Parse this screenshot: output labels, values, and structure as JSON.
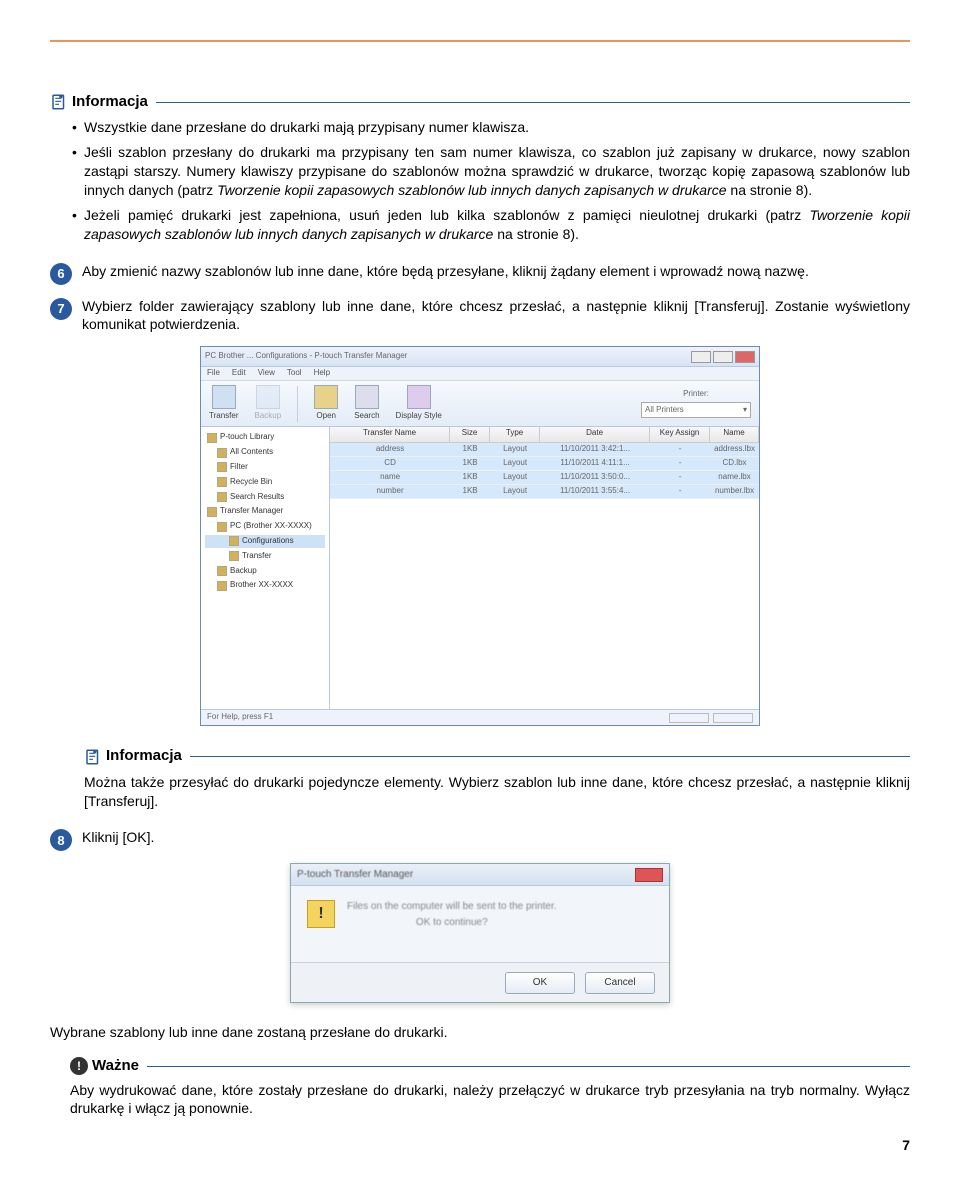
{
  "note1": {
    "title": "Informacja",
    "bullets": [
      {
        "text": "Wszystkie dane przesłane do drukarki mają przypisany numer klawisza."
      },
      {
        "text": "Jeśli szablon przesłany do drukarki ma przypisany ten sam numer klawisza, co szablon już zapisany w drukarce, nowy szablon zastąpi starszy. Numery klawiszy przypisane do szablonów można sprawdzić w drukarce, tworząc kopię zapasową szablonów lub innych danych (patrz ",
        "italic": "Tworzenie kopii zapasowych szablonów lub innych danych zapisanych w drukarce",
        "after": " na stronie 8)."
      },
      {
        "text": "Jeżeli pamięć drukarki jest zapełniona, usuń jeden lub kilka szablonów z pamięci nieulotnej drukarki (patrz ",
        "italic": "Tworzenie kopii zapasowych szablonów lub innych danych zapisanych w drukarce",
        "after": " na stronie 8)."
      }
    ]
  },
  "step6": {
    "num": "6",
    "text": "Aby zmienić nazwy szablonów lub inne dane, które będą przesyłane, kliknij żądany element i wprowadź nową nazwę."
  },
  "step7": {
    "num": "7",
    "text": "Wybierz folder zawierający szablony lub inne dane, które chcesz przesłać, a następnie kliknij [Transferuj]. Zostanie wyświetlony komunikat potwierdzenia."
  },
  "screenshot1": {
    "title": "PC Brother ... Configurations - P-touch Transfer Manager",
    "menu": [
      "File",
      "Edit",
      "View",
      "Tool",
      "Help"
    ],
    "toolbar": [
      "Transfer",
      "Backup",
      "Open",
      "Search",
      "Display Style"
    ],
    "printerLabel": "Printer:",
    "printerCombo": "All Printers",
    "tree": [
      {
        "label": "P-touch Library",
        "indent": 0
      },
      {
        "label": "All Contents",
        "indent": 1
      },
      {
        "label": "Filter",
        "indent": 1
      },
      {
        "label": "Recycle Bin",
        "indent": 1
      },
      {
        "label": "Search Results",
        "indent": 1
      },
      {
        "label": "Transfer Manager",
        "indent": 0
      },
      {
        "label": "PC (Brother XX-XXXX)",
        "indent": 1
      },
      {
        "label": "Configurations",
        "indent": 2,
        "sel": true
      },
      {
        "label": "Transfer",
        "indent": 2
      },
      {
        "label": "Backup",
        "indent": 1
      },
      {
        "label": "Brother XX-XXXX",
        "indent": 1
      }
    ],
    "cols": [
      "Transfer Name",
      "Size",
      "Type",
      "Date",
      "Key Assign",
      "Name"
    ],
    "rows": [
      {
        "sel": true,
        "cells": [
          "address",
          "1KB",
          "Layout",
          "11/10/2011 3:42:1...",
          "-",
          "address.lbx"
        ]
      },
      {
        "sel": true,
        "cells": [
          "CD",
          "1KB",
          "Layout",
          "11/10/2011 4:11:1...",
          "-",
          "CD.lbx"
        ]
      },
      {
        "sel": true,
        "cells": [
          "name",
          "1KB",
          "Layout",
          "11/10/2011 3:50:0...",
          "-",
          "name.lbx"
        ]
      },
      {
        "sel": true,
        "cells": [
          "number",
          "1KB",
          "Layout",
          "11/10/2011 3:55:4...",
          "-",
          "number.lbx"
        ]
      }
    ],
    "status": "For Help, press F1"
  },
  "note2": {
    "title": "Informacja",
    "text": "Można także przesyłać do drukarki pojedyncze elementy. Wybierz szablon lub inne dane, które chcesz przesłać, a następnie kliknij [Transferuj]."
  },
  "step8": {
    "num": "8",
    "text": "Kliknij [OK]."
  },
  "screenshot2": {
    "title": "P-touch Transfer Manager",
    "line1": "Files on the computer will be sent to the printer.",
    "line2": "OK to continue?",
    "ok": "OK",
    "cancel": "Cancel"
  },
  "afterStep8": "Wybrane szablony lub inne dane zostaną przesłane do drukarki.",
  "important": {
    "title": "Ważne",
    "text": "Aby wydrukować dane, które zostały przesłane do drukarki, należy przełączyć w drukarce tryb przesyłania na tryb normalny. Wyłącz drukarkę i włącz ją ponownie."
  },
  "pageNum": "7"
}
